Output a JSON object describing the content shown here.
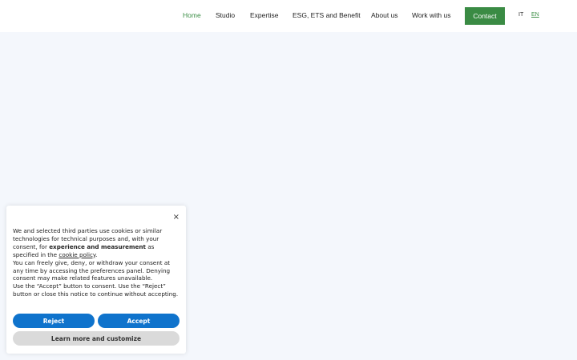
{
  "header": {
    "nav": [
      {
        "label": "Home",
        "active": true
      },
      {
        "label": "Studio",
        "active": false
      },
      {
        "label": "Expertise",
        "active": false
      },
      {
        "label": "ESG, ETS and Benefit",
        "active": false
      },
      {
        "label": "About us",
        "active": false
      },
      {
        "label": "Work with us",
        "active": false
      }
    ],
    "contact_label": "Contact",
    "languages": [
      {
        "label": "IT",
        "active": false
      },
      {
        "label": "EN",
        "active": true
      }
    ]
  },
  "cookie_banner": {
    "close_icon": "×",
    "text_1": "We and selected third parties use cookies or similar technologies for technical purposes and, with your consent, for ",
    "text_1_bold": "experience and measurement",
    "text_1_after": " as specified in the ",
    "cookie_policy_link": "cookie policy",
    "text_1_end": ".",
    "text_2": "You can freely give, deny, or withdraw your consent at any time by accessing the preferences panel. Denying consent may make related features unavailable.",
    "text_3": "Use the “Accept” button to consent. Use the “Reject” button or close this notice to continue without accepting.",
    "reject_label": "Reject",
    "accept_label": "Accept",
    "learn_more_label": "Learn more and customize"
  },
  "colors": {
    "accent_green": "#3a8b44",
    "button_blue": "#0f73cc",
    "background": "#f4f7fc"
  }
}
